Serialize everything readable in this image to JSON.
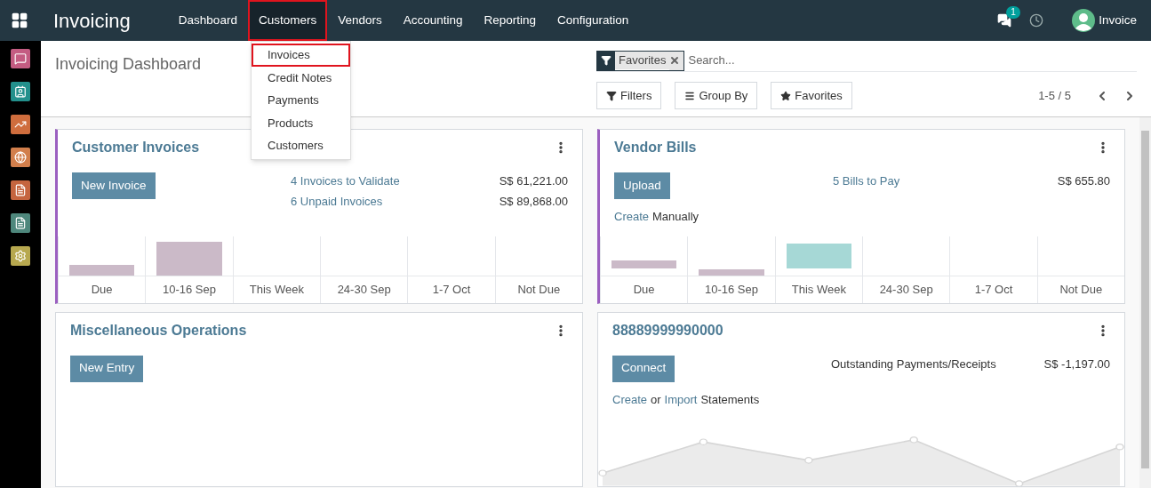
{
  "app_title": "Invoicing",
  "menu": [
    {
      "label": "Dashboard",
      "selected": false,
      "highlighted": false
    },
    {
      "label": "Customers",
      "selected": true,
      "highlighted": true
    },
    {
      "label": "Vendors",
      "selected": false,
      "highlighted": false
    },
    {
      "label": "Accounting",
      "selected": false,
      "highlighted": false
    },
    {
      "label": "Reporting",
      "selected": false,
      "highlighted": false
    },
    {
      "label": "Configuration",
      "selected": false,
      "highlighted": false
    }
  ],
  "dropdown": [
    {
      "label": "Invoices",
      "highlighted": true
    },
    {
      "label": "Credit Notes",
      "highlighted": false
    },
    {
      "label": "Payments",
      "highlighted": false
    },
    {
      "label": "Products",
      "highlighted": false
    },
    {
      "label": "Customers",
      "highlighted": false
    }
  ],
  "messages_badge": "1",
  "user_name": "Invoice",
  "sidebar": [
    {
      "kind": "chat",
      "color": "#c45c82"
    },
    {
      "kind": "contacts",
      "color": "#23908c"
    },
    {
      "kind": "chart",
      "color": "#cf6d3d"
    },
    {
      "kind": "globe",
      "color": "#d27f4c"
    },
    {
      "kind": "invoice",
      "color": "#c5653f"
    },
    {
      "kind": "document",
      "color": "#4e877c"
    },
    {
      "kind": "settings",
      "color": "#b7a84f"
    }
  ],
  "page_title": "Invoicing Dashboard",
  "search": {
    "facet": "Favorites",
    "placeholder": "Search..."
  },
  "buttons": [
    "Filters",
    "Group By",
    "Favorites"
  ],
  "pager": "1-5 / 5",
  "cards": [
    {
      "kind": "bar_graph",
      "title": "Customer Invoices",
      "accent": true,
      "button": "New Invoice",
      "stats": [
        {
          "label": "4 Invoices to Validate",
          "link": true,
          "amount": "S$ 61,221.00"
        },
        {
          "label": "6 Unpaid Invoices",
          "link": true,
          "amount": "S$ 89,868.00"
        }
      ],
      "categories": [
        "Due",
        "10-16 Sep",
        "This Week",
        "24-30 Sep",
        "1-7 Oct",
        "Not Due"
      ]
    },
    {
      "kind": "bar_graph",
      "title": "Vendor Bills",
      "accent": true,
      "button": "Upload",
      "stats": [
        {
          "label": "5 Bills to Pay",
          "link": true,
          "amount": "S$ 655.80"
        }
      ],
      "links": [
        {
          "text": "Create",
          "link": true
        },
        {
          "text": "Manually",
          "link": false
        }
      ],
      "categories": [
        "Due",
        "10-16 Sep",
        "This Week",
        "24-30 Sep",
        "1-7 Oct",
        "Not Due"
      ]
    },
    {
      "kind": "plain",
      "title": "Miscellaneous Operations",
      "accent": false,
      "button": "New Entry"
    },
    {
      "kind": "line_graph",
      "title": "88889999990000",
      "accent": false,
      "button": "Connect",
      "stats": [
        {
          "label": "Outstanding Payments/Receipts",
          "link": false,
          "amount": "S$ -1,197.00"
        }
      ],
      "links": [
        {
          "text": "Create",
          "link": true
        },
        {
          "text": "or",
          "link": false
        },
        {
          "text": "Import",
          "link": true
        },
        {
          "text": "Statements",
          "link": false
        }
      ]
    }
  ]
}
